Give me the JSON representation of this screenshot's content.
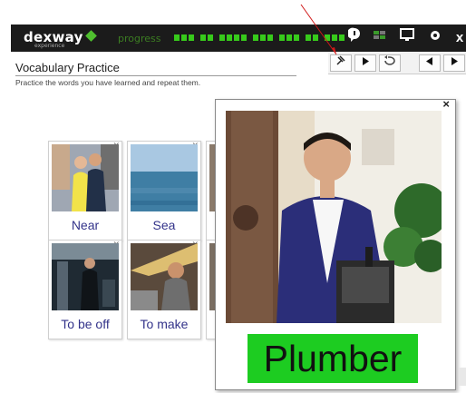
{
  "topbar": {
    "logo": "dexway",
    "logo_sub": "experience",
    "progress_label": "progress",
    "progress": 0.7
  },
  "page": {
    "title": "Vocabulary Practice",
    "subtitle": "Practice the words you have learned and repeat them."
  },
  "cards": [
    {
      "label": "Near"
    },
    {
      "label": "Sea"
    },
    {
      "label": "To be off"
    },
    {
      "label": "To make"
    }
  ],
  "popup": {
    "word": "Plumber",
    "close": "×"
  },
  "colors": {
    "accent": "#37ca1b",
    "topbar": "#1b1b1b",
    "label": "#33338a",
    "word_bg": "#1dcc21"
  },
  "icons": {
    "top_tools": [
      "info-icon",
      "flag-icon",
      "screen-icon",
      "gear-icon",
      "close-icon"
    ],
    "controls": [
      "microphone-icon",
      "play-icon",
      "repeat-icon",
      "previous-icon",
      "next-icon"
    ]
  }
}
